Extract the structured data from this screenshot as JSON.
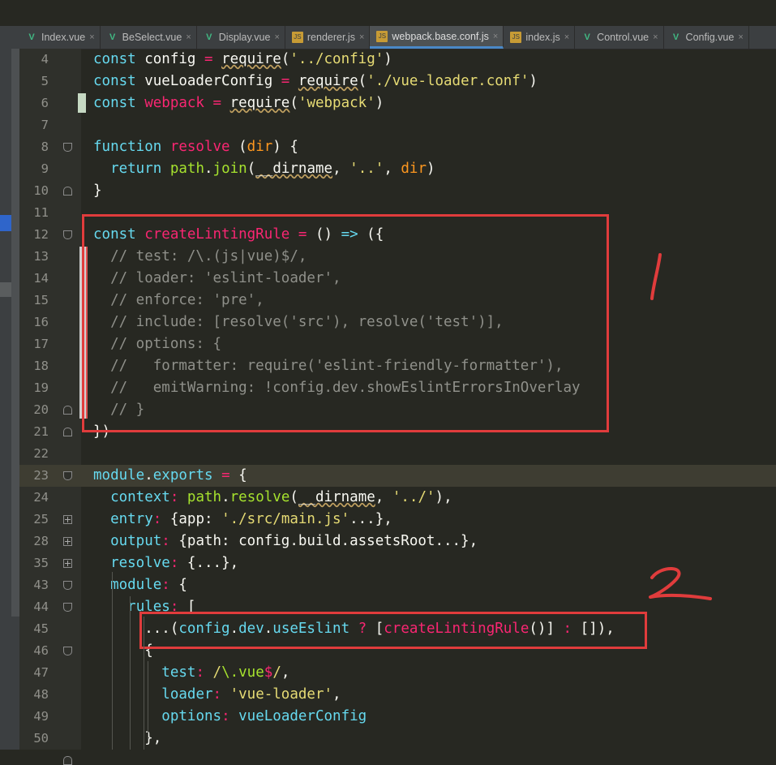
{
  "tabs": [
    {
      "label": "Index.vue",
      "icon": "vue-file-icon",
      "active": false
    },
    {
      "label": "BeSelect.vue",
      "icon": "vue-file-icon",
      "active": false
    },
    {
      "label": "Display.vue",
      "icon": "vue-file-icon",
      "active": false
    },
    {
      "label": "renderer.js",
      "icon": "js-file-icon",
      "active": false
    },
    {
      "label": "webpack.base.conf.js",
      "icon": "js-file-icon",
      "active": true
    },
    {
      "label": "index.js",
      "icon": "js-file-icon",
      "active": false
    },
    {
      "label": "Control.vue",
      "icon": "vue-file-icon",
      "active": false
    },
    {
      "label": "Config.vue",
      "icon": "vue-file-icon",
      "active": false
    }
  ],
  "icons": {
    "close": "×",
    "vue": "V",
    "js": "JS"
  },
  "lines": [
    {
      "n": "4",
      "tokens": [
        [
          "k",
          "const "
        ],
        [
          "p",
          "config "
        ],
        [
          "r",
          "= "
        ],
        [
          "u",
          "require"
        ],
        [
          "p",
          "("
        ],
        [
          "s",
          "'../config'"
        ],
        [
          "p",
          ")"
        ]
      ]
    },
    {
      "n": "5",
      "tokens": [
        [
          "k",
          "const "
        ],
        [
          "p",
          "vueLoaderConfig "
        ],
        [
          "r",
          "= "
        ],
        [
          "u",
          "require"
        ],
        [
          "p",
          "("
        ],
        [
          "s",
          "'./vue-loader.conf'"
        ],
        [
          "p",
          ")"
        ]
      ]
    },
    {
      "n": "6",
      "tokens": [
        [
          "k",
          "const "
        ],
        [
          "r",
          "webpack "
        ],
        [
          "r",
          "= "
        ],
        [
          "u",
          "require"
        ],
        [
          "p",
          "("
        ],
        [
          "s",
          "'webpack'"
        ],
        [
          "p",
          ")"
        ]
      ]
    },
    {
      "n": "7",
      "tokens": []
    },
    {
      "n": "8",
      "tokens": [
        [
          "k",
          "function "
        ],
        [
          "r",
          "resolve "
        ],
        [
          "p",
          "("
        ],
        [
          "v",
          "dir"
        ],
        [
          "p",
          ") {"
        ]
      ]
    },
    {
      "n": "9",
      "tokens": [
        [
          "p",
          "  "
        ],
        [
          "k",
          "return "
        ],
        [
          "f",
          "path"
        ],
        [
          "p",
          "."
        ],
        [
          "f",
          "join"
        ],
        [
          "p",
          "("
        ],
        [
          "u",
          "__dirname"
        ],
        [
          "p",
          ", "
        ],
        [
          "s",
          "'..'"
        ],
        [
          "p",
          ", "
        ],
        [
          "v",
          "dir"
        ],
        [
          "p",
          ")"
        ]
      ]
    },
    {
      "n": "10",
      "tokens": [
        [
          "p",
          "}"
        ]
      ]
    },
    {
      "n": "11",
      "tokens": []
    },
    {
      "n": "12",
      "tokens": [
        [
          "k",
          "const "
        ],
        [
          "r",
          "createLintingRule "
        ],
        [
          "r",
          "= "
        ],
        [
          "p",
          "() "
        ],
        [
          "k",
          "=> "
        ],
        [
          "p",
          "({"
        ]
      ]
    },
    {
      "n": "13",
      "tokens": [
        [
          "c",
          "  // test: /\\.(js|vue)$/,"
        ]
      ]
    },
    {
      "n": "14",
      "tokens": [
        [
          "c",
          "  // loader: 'eslint-loader',"
        ]
      ]
    },
    {
      "n": "15",
      "tokens": [
        [
          "c",
          "  // enforce: 'pre',"
        ]
      ]
    },
    {
      "n": "16",
      "tokens": [
        [
          "c",
          "  // include: [resolve('src'), resolve('test')],"
        ]
      ]
    },
    {
      "n": "17",
      "tokens": [
        [
          "c",
          "  // options: {"
        ]
      ]
    },
    {
      "n": "18",
      "tokens": [
        [
          "c",
          "  //   formatter: require('eslint-friendly-formatter'),"
        ]
      ]
    },
    {
      "n": "19",
      "tokens": [
        [
          "c",
          "  //   emitWarning: !config.dev.showEslintErrorsInOverlay"
        ]
      ]
    },
    {
      "n": "20",
      "tokens": [
        [
          "c",
          "  // }"
        ]
      ]
    },
    {
      "n": "21",
      "tokens": [
        [
          "p",
          "})"
        ]
      ]
    },
    {
      "n": "22",
      "tokens": []
    },
    {
      "n": "23",
      "tokens": [
        [
          "k",
          "module"
        ],
        [
          "p",
          "."
        ],
        [
          "k",
          "exports "
        ],
        [
          "r",
          "= "
        ],
        [
          "p",
          "{"
        ]
      ],
      "current": true
    },
    {
      "n": "24",
      "tokens": [
        [
          "p",
          "  "
        ],
        [
          "k",
          "context"
        ],
        [
          "r",
          ": "
        ],
        [
          "f",
          "path"
        ],
        [
          "p",
          "."
        ],
        [
          "f",
          "resolve"
        ],
        [
          "p",
          "("
        ],
        [
          "u",
          "__dirname"
        ],
        [
          "p",
          ", "
        ],
        [
          "s",
          "'../'"
        ],
        [
          "p",
          "),"
        ]
      ]
    },
    {
      "n": "25",
      "tokens": [
        [
          "p",
          "  "
        ],
        [
          "k",
          "entry"
        ],
        [
          "r",
          ": "
        ],
        [
          "p",
          "{app: "
        ],
        [
          "s",
          "'./src/main.js'"
        ],
        [
          "p",
          "...},"
        ]
      ]
    },
    {
      "n": "28",
      "tokens": [
        [
          "p",
          "  "
        ],
        [
          "k",
          "output"
        ],
        [
          "r",
          ": "
        ],
        [
          "p",
          "{path: config.build.assetsRoot...},"
        ]
      ]
    },
    {
      "n": "35",
      "tokens": [
        [
          "p",
          "  "
        ],
        [
          "k",
          "resolve"
        ],
        [
          "r",
          ": "
        ],
        [
          "p",
          "{...},"
        ]
      ]
    },
    {
      "n": "43",
      "tokens": [
        [
          "p",
          "  "
        ],
        [
          "k",
          "module"
        ],
        [
          "r",
          ": "
        ],
        [
          "p",
          "{"
        ]
      ]
    },
    {
      "n": "44",
      "tokens": [
        [
          "p",
          "    "
        ],
        [
          "k",
          "rules"
        ],
        [
          "r",
          ": "
        ],
        [
          "p",
          "["
        ]
      ]
    },
    {
      "n": "45",
      "tokens": [
        [
          "p",
          "      ...("
        ],
        [
          "k",
          "config"
        ],
        [
          "p",
          "."
        ],
        [
          "k",
          "dev"
        ],
        [
          "p",
          "."
        ],
        [
          "k",
          "useEslint "
        ],
        [
          "r",
          "? "
        ],
        [
          "p",
          "["
        ],
        [
          "r",
          "createLintingRule"
        ],
        [
          "p",
          "()] "
        ],
        [
          "r",
          ": "
        ],
        [
          "p",
          "[]),"
        ]
      ]
    },
    {
      "n": "46",
      "tokens": [
        [
          "p",
          "      {"
        ]
      ]
    },
    {
      "n": "47",
      "tokens": [
        [
          "p",
          "        "
        ],
        [
          "k",
          "test"
        ],
        [
          "r",
          ": "
        ],
        [
          "s",
          "/"
        ],
        [
          "f",
          "\\.vue"
        ],
        [
          "r",
          "$"
        ],
        [
          "s",
          "/"
        ],
        [
          "p",
          ","
        ]
      ]
    },
    {
      "n": "48",
      "tokens": [
        [
          "p",
          "        "
        ],
        [
          "k",
          "loader"
        ],
        [
          "r",
          ": "
        ],
        [
          "s",
          "'vue-loader'"
        ],
        [
          "p",
          ","
        ]
      ]
    },
    {
      "n": "49",
      "tokens": [
        [
          "p",
          "        "
        ],
        [
          "k",
          "options"
        ],
        [
          "r",
          ": "
        ],
        [
          "k",
          "vueLoaderConfig"
        ]
      ]
    },
    {
      "n": "50",
      "tokens": [
        [
          "p",
          "      },"
        ]
      ]
    }
  ],
  "annotations": {
    "one": "1",
    "two": "2",
    "color": "#e03c3c"
  }
}
